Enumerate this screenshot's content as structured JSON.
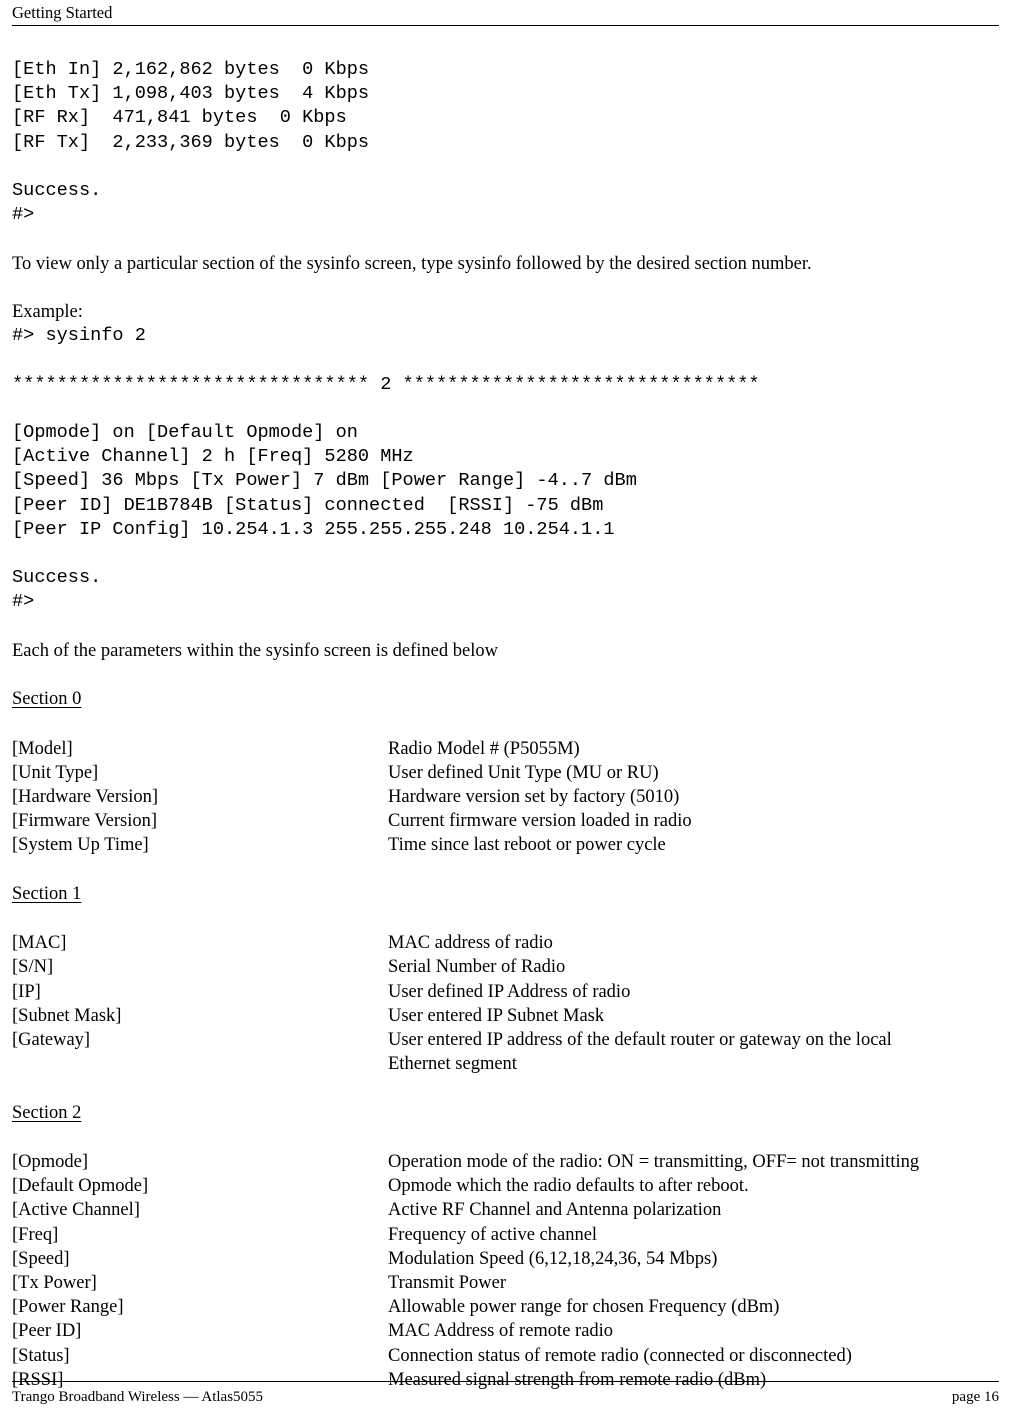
{
  "header": {
    "title": "Getting Started"
  },
  "terminal_stats": {
    "lines": [
      "[Eth In] 2,162,862 bytes  0 Kbps",
      "[Eth Tx] 1,098,403 bytes  4 Kbps",
      "[RF Rx]  471,841 bytes  0 Kbps",
      "[RF Tx]  2,233,369 bytes  0 Kbps"
    ],
    "result": "Success.",
    "prompt": "#>"
  },
  "intro_paragraph": "To view only a particular section of the sysinfo screen, type sysinfo followed by the desired section number.",
  "example": {
    "label": "Example:",
    "command": "#> sysinfo 2"
  },
  "sysinfo_output": {
    "separator": "******************************** 2 ********************************",
    "lines": [
      "[Opmode] on [Default Opmode] on",
      "[Active Channel] 2 h [Freq] 5280 MHz",
      "[Speed] 36 Mbps [Tx Power] 7 dBm [Power Range] -4..7 dBm",
      "[Peer ID] DE1B784B [Status] connected  [RSSI] -75 dBm",
      "[Peer IP Config] 10.254.1.3 255.255.255.248 10.254.1.1"
    ],
    "result": "Success.",
    "prompt": "#>"
  },
  "definitions_intro": "Each of the parameters within the sysinfo screen is defined below",
  "sections": [
    {
      "heading": "Section 0",
      "rows": [
        {
          "term": "[Model]",
          "desc": "Radio Model # (P5055M)"
        },
        {
          "term": "[Unit Type]",
          "desc": "User defined Unit Type (MU or RU)"
        },
        {
          "term": "[Hardware Version]",
          "desc": "Hardware version set by factory (5010)"
        },
        {
          "term": "[Firmware Version]",
          "desc": "Current firmware version loaded in radio"
        },
        {
          "term": "[System Up Time]",
          "desc": "Time since last reboot or power cycle"
        }
      ]
    },
    {
      "heading": "Section 1",
      "rows": [
        {
          "term": "[MAC]",
          "desc": "MAC address of radio"
        },
        {
          "term": "[S/N]",
          "desc": "Serial Number of Radio"
        },
        {
          "term": "[IP]",
          "desc": "User defined IP Address of radio"
        },
        {
          "term": "[Subnet Mask]",
          "desc": "User entered IP Subnet Mask"
        },
        {
          "term": "[Gateway]",
          "desc": "User entered IP address of the default router or gateway on the local\nEthernet segment"
        }
      ]
    },
    {
      "heading": "Section 2",
      "rows": [
        {
          "term": "[Opmode]",
          "desc": "Operation mode of the radio: ON = transmitting, OFF= not transmitting"
        },
        {
          "term": "[Default Opmode]",
          "desc": "Opmode which the radio defaults to after reboot."
        },
        {
          "term": "[Active Channel]",
          "desc": "Active RF Channel and Antenna polarization"
        },
        {
          "term": "[Freq]",
          "desc": "Frequency of active channel"
        },
        {
          "term": "[Speed]",
          "desc": "Modulation Speed (6,12,18,24,36, 54 Mbps)"
        },
        {
          "term": "[Tx Power]",
          "desc": "Transmit Power"
        },
        {
          "term": "[Power Range]",
          "desc": "Allowable power range for chosen Frequency (dBm)"
        },
        {
          "term": "[Peer ID]",
          "desc": "MAC Address of remote radio"
        },
        {
          "term": "[Status]",
          "desc": "Connection status of remote radio (connected or disconnected)"
        },
        {
          "term": "[RSSI]",
          "desc": "Measured signal strength from remote radio (dBm)"
        }
      ]
    }
  ],
  "footer": {
    "left": "Trango Broadband Wireless — Atlas5055",
    "right": "page 16"
  }
}
